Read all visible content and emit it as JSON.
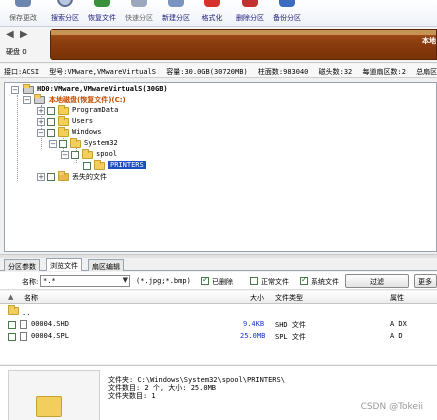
{
  "toolbar": {
    "items": [
      {
        "label": "保存更改",
        "icon": "save-icon"
      },
      {
        "label": "搜索分区",
        "icon": "search-partition-icon"
      },
      {
        "label": "恢复文件",
        "icon": "recover-file-icon"
      },
      {
        "label": "快速分区",
        "icon": "quick-partition-icon"
      },
      {
        "label": "新建分区",
        "icon": "new-partition-icon"
      },
      {
        "label": "格式化",
        "icon": "format-icon"
      },
      {
        "label": "删除分区",
        "icon": "delete-partition-icon"
      },
      {
        "label": "备份分区",
        "icon": "backup-partition-icon"
      }
    ]
  },
  "disk_strip": {
    "disk_label": "硬盘 0",
    "partition_label": "本地",
    "partition_color": "#8a3c0d"
  },
  "info_line": {
    "interface": "接口:ACSI",
    "model": "型号:VMware,VMwareVirtualS",
    "capacity": "容量:30.0GB(30720MB)",
    "cylinders": "柱面数:983040",
    "heads": "磁头数:32",
    "sectors": "每道扇区数:2",
    "total": "总扇区"
  },
  "tree": {
    "disk": "HD0:VMware,VMwareVirtualS(30GB)",
    "volume": "本地磁盘(恢复文件)(C:)",
    "items": [
      "ProgramData",
      "Users",
      "Windows",
      "System32",
      "spool",
      "PRINTERS"
    ],
    "lost": "丢失的文件"
  },
  "tabs": [
    "分区参数",
    "浏览文件",
    "扇区编辑"
  ],
  "filter": {
    "name_label": "名称:",
    "name_value": "*.*",
    "hint": "(*.jpg;*.bmp)",
    "deleted_label": "已删除",
    "normal_label": "正常文件",
    "system_label": "系统文件",
    "filter_button": "过滤",
    "more_button": "更多"
  },
  "list": {
    "headers": {
      "name": "名称",
      "size": "大小",
      "type": "文件类型",
      "attr": "属性"
    },
    "parent": "..",
    "rows": [
      {
        "name": "00004.SHD",
        "size": "9.4KB",
        "type": "SHD 文件",
        "attr": "A DX"
      },
      {
        "name": "00004.SPL",
        "size": "25.0MB",
        "type": "SPL 文件",
        "attr": "A D"
      }
    ]
  },
  "summary": {
    "folder": "文件夹: C:\\Windows\\System32\\spool\\PRINTERS\\",
    "count": "文件数目: 2 个, 大小: 25.0MB",
    "folder_count": "文件夹数目: 1"
  },
  "watermark": "CSDN @Tokeii",
  "colors": {
    "volume_text": "#c05000",
    "selected_bg": "#1c4fbf",
    "link_blue": "#1a33cc"
  }
}
